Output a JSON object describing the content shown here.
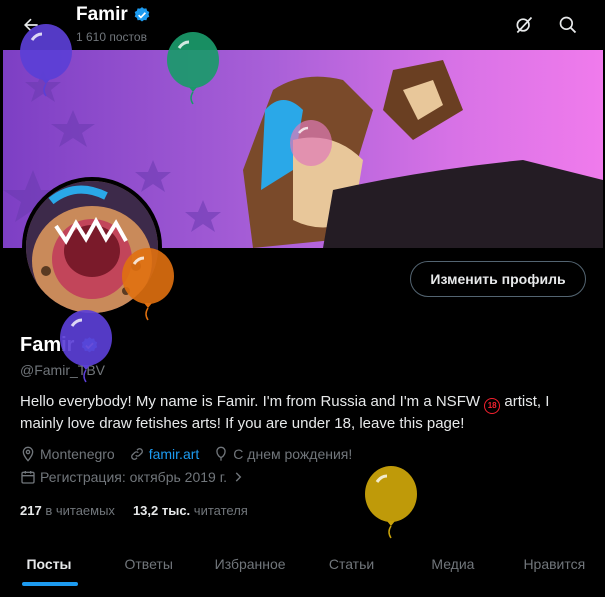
{
  "header": {
    "name": "Famir",
    "posts": "1 610 постов",
    "back_icon": "arrow-left-icon",
    "grok_icon": "grok-icon",
    "search_icon": "search-icon"
  },
  "profile": {
    "edit_button": "Изменить профиль",
    "name": "Famir",
    "handle": "@Famir_TBV",
    "bio_part1": "Hello everybody! My name is Famir. I'm from Russia and I'm a NSFW ",
    "bio_badge": "18",
    "bio_part2": " artist, I mainly love draw fetishes arts! If you are under 18, leave this page!",
    "location": "Montenegro",
    "website": "famir.art",
    "birthday": "С днем рождения!",
    "joined": "Регистрация: октябрь 2019 г.",
    "verified_color": "#1d9bf0"
  },
  "stats": {
    "following_count": "217",
    "following_label": "в читаемых",
    "followers_count": "13,2 тыс.",
    "followers_label": "читателя"
  },
  "tabs": [
    "Посты",
    "Ответы",
    "Избранное",
    "Статьи",
    "Медиа",
    "Нравится"
  ],
  "balloon_colors": {
    "purple": "#5b3fd6",
    "green": "#1a9a6a",
    "pink": "#e07ab8",
    "orange": "#e0700f",
    "gold": "#c9a20a"
  }
}
